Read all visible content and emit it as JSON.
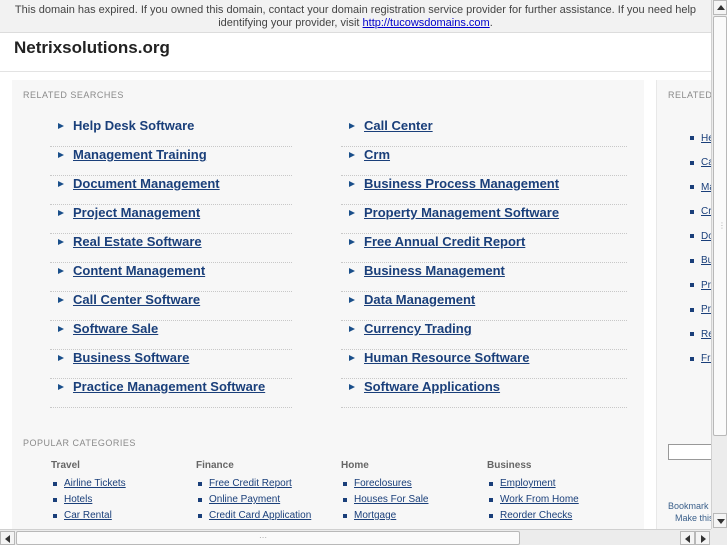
{
  "notice": {
    "text_before": "This domain has expired. If you owned this domain, contact your domain registration service provider for further assistance. If you need help identifying your provider, visit ",
    "link": "http://tucowsdomains.com",
    "text_after": "."
  },
  "site_title": "Netrixsolutions.org",
  "related_searches": {
    "heading": "RELATED SEARCHES",
    "left": [
      "Help Desk Software",
      "Management Training",
      "Document Management",
      "Project Management",
      "Real Estate Software",
      "Content Management",
      "Call Center Software",
      "Software Sale",
      "Business Software",
      "Practice Management Software"
    ],
    "right": [
      "Call Center",
      "Crm",
      "Business Process Management",
      "Property Management Software",
      "Free Annual Credit Report",
      "Business Management",
      "Data Management",
      "Currency Trading",
      "Human Resource Software",
      "Software Applications"
    ]
  },
  "popular_categories": {
    "heading": "POPULAR CATEGORIES",
    "groups": [
      {
        "title": "Travel",
        "links": [
          "Airline Tickets",
          "Hotels",
          "Car Rental"
        ]
      },
      {
        "title": "Finance",
        "links": [
          "Free Credit Report",
          "Online Payment",
          "Credit Card Application"
        ]
      },
      {
        "title": "Home",
        "links": [
          "Foreclosures",
          "Houses For Sale",
          "Mortgage"
        ]
      },
      {
        "title": "Business",
        "links": [
          "Employment",
          "Work From Home",
          "Reorder Checks"
        ]
      }
    ]
  },
  "right_panel": {
    "heading": "RELATED",
    "items": [
      "Help",
      "Call",
      "Ma",
      "Crm",
      "Doc",
      "Bus",
      "Pro",
      "Pro",
      "Rea",
      "Free"
    ],
    "bookmark_line1": "Bookmark",
    "bookmark_line2": "Make this"
  },
  "colors": {
    "link": "#1a3f7a",
    "panel_bg": "#f7f7f7",
    "notice_bg": "#f2f2f2",
    "notice_link": "#0000cc"
  }
}
